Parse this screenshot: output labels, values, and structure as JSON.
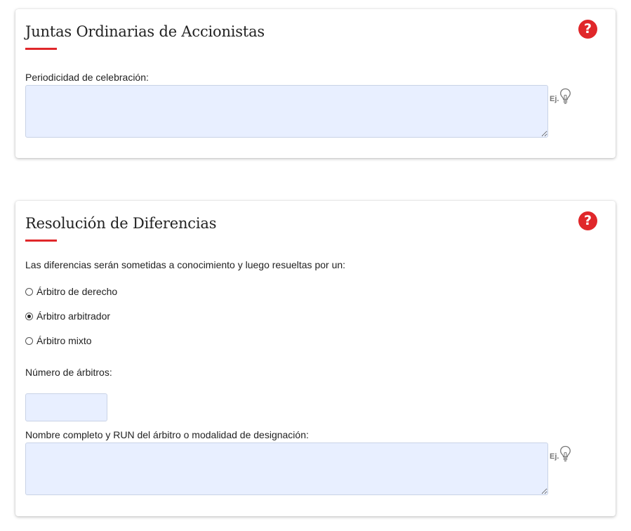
{
  "colors": {
    "accent": "#e0272a",
    "field_background": "#e8efff",
    "field_border": "#c9d3e6"
  },
  "section_juntas": {
    "title": "Juntas Ordinarias de Accionistas",
    "help_icon": "question-circle-icon",
    "help_text": "?",
    "periodicidad_label": "Periodicidad de celebración:",
    "periodicidad_value": "",
    "example_label": "Ej.",
    "example_icon": "lightbulb-icon"
  },
  "section_resolucion": {
    "title": "Resolución de Diferencias",
    "help_icon": "question-circle-icon",
    "help_text": "?",
    "intro_text": "Las diferencias serán sometidas a conocimiento y luego resueltas por un:",
    "options": [
      {
        "label": "Árbitro de derecho",
        "checked": false
      },
      {
        "label": "Árbitro arbitrador",
        "checked": true
      },
      {
        "label": "Árbitro mixto",
        "checked": false
      }
    ],
    "numero_label": "Número de árbitros:",
    "numero_value": "",
    "nombre_label": "Nombre completo y RUN del árbitro o modalidad de designación:",
    "nombre_value": "",
    "example_label": "Ej.",
    "example_icon": "lightbulb-icon"
  }
}
